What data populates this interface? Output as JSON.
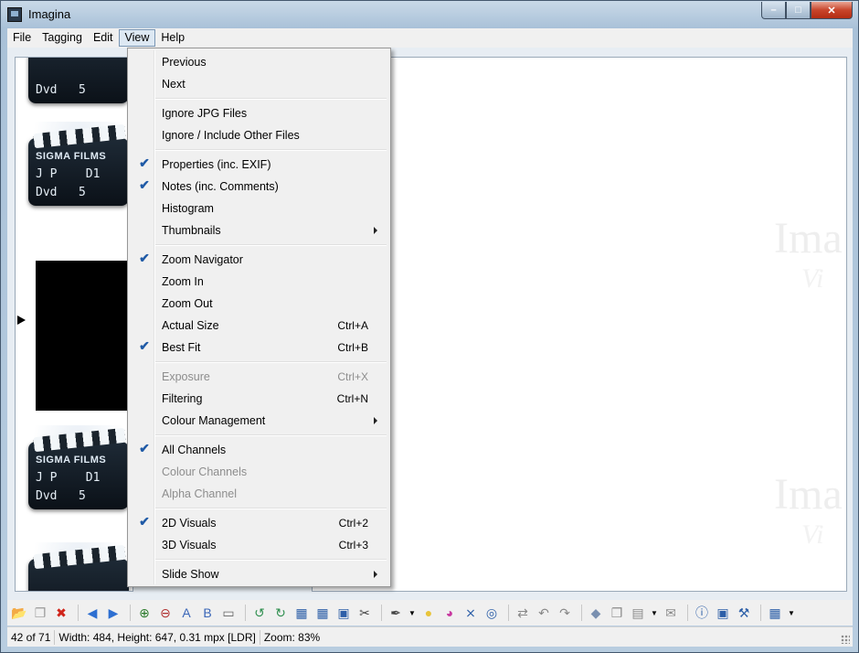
{
  "window": {
    "title": "Imagina"
  },
  "menubar": [
    "File",
    "Tagging",
    "Edit",
    "View",
    "Help"
  ],
  "view_menu": {
    "groups": [
      [
        {
          "label": "Previous",
          "shortcut": "",
          "checked": false,
          "disabled": false,
          "submenu": false
        },
        {
          "label": "Next",
          "shortcut": "",
          "checked": false,
          "disabled": false,
          "submenu": false
        }
      ],
      [
        {
          "label": "Ignore JPG Files",
          "shortcut": "",
          "checked": false,
          "disabled": false,
          "submenu": false
        },
        {
          "label": "Ignore / Include Other Files",
          "shortcut": "",
          "checked": false,
          "disabled": false,
          "submenu": false
        }
      ],
      [
        {
          "label": "Properties (inc. EXIF)",
          "shortcut": "",
          "checked": true,
          "disabled": false,
          "submenu": false
        },
        {
          "label": "Notes (inc. Comments)",
          "shortcut": "",
          "checked": true,
          "disabled": false,
          "submenu": false
        },
        {
          "label": "Histogram",
          "shortcut": "",
          "checked": false,
          "disabled": false,
          "submenu": false
        },
        {
          "label": "Thumbnails",
          "shortcut": "",
          "checked": false,
          "disabled": false,
          "submenu": true
        }
      ],
      [
        {
          "label": "Zoom Navigator",
          "shortcut": "",
          "checked": true,
          "disabled": false,
          "submenu": false
        },
        {
          "label": "Zoom In",
          "shortcut": "",
          "checked": false,
          "disabled": false,
          "submenu": false
        },
        {
          "label": "Zoom Out",
          "shortcut": "",
          "checked": false,
          "disabled": false,
          "submenu": false
        },
        {
          "label": "Actual Size",
          "shortcut": "Ctrl+A",
          "checked": false,
          "disabled": false,
          "submenu": false
        },
        {
          "label": "Best Fit",
          "shortcut": "Ctrl+B",
          "checked": true,
          "disabled": false,
          "submenu": false
        }
      ],
      [
        {
          "label": "Exposure",
          "shortcut": "Ctrl+X",
          "checked": false,
          "disabled": true,
          "submenu": false
        },
        {
          "label": "Filtering",
          "shortcut": "Ctrl+N",
          "checked": false,
          "disabled": false,
          "submenu": false
        },
        {
          "label": "Colour Management",
          "shortcut": "",
          "checked": false,
          "disabled": false,
          "submenu": true
        }
      ],
      [
        {
          "label": "All Channels",
          "shortcut": "",
          "checked": true,
          "disabled": false,
          "submenu": false
        },
        {
          "label": "Colour Channels",
          "shortcut": "",
          "checked": false,
          "disabled": true,
          "submenu": false
        },
        {
          "label": "Alpha Channel",
          "shortcut": "",
          "checked": false,
          "disabled": true,
          "submenu": false
        }
      ],
      [
        {
          "label": "2D Visuals",
          "shortcut": "Ctrl+2",
          "checked": true,
          "disabled": false,
          "submenu": false
        },
        {
          "label": "3D Visuals",
          "shortcut": "Ctrl+3",
          "checked": false,
          "disabled": false,
          "submenu": false
        }
      ],
      [
        {
          "label": "Slide Show",
          "shortcut": "",
          "checked": false,
          "disabled": false,
          "submenu": true
        }
      ]
    ]
  },
  "thumbnails": {
    "brand": "SIGMA FILMS",
    "row1": "J P",
    "row1_right": "D1",
    "row2": "Dvd",
    "row2_right": "5"
  },
  "viewer": {
    "watermark_big": "Ima",
    "watermark_small": "Vi"
  },
  "toolbar_icons": [
    "open-folder-icon",
    "copy-icon",
    "delete-icon",
    "previous-icon",
    "next-icon",
    "zoom-in-icon",
    "zoom-out-icon",
    "font-a-icon",
    "font-b-icon",
    "frame-icon",
    "rotate-left-icon",
    "rotate-right-icon",
    "grid-icon",
    "grid2-icon",
    "fill-icon",
    "scissors-icon",
    "eyedropper-icon",
    "bulb-icon",
    "colour-wheel-icon",
    "chart-icon",
    "radar-icon",
    "swap-icon",
    "undo-icon",
    "redo-icon",
    "tag-icon",
    "duplicate-icon",
    "stack-icon",
    "mail-icon",
    "info-icon",
    "save-icon",
    "settings-icon",
    "layout-icon"
  ],
  "status": {
    "position": "42 of 71",
    "details": "Width: 484, Height: 647, 0.31 mpx [LDR]",
    "zoom": "Zoom: 83%"
  }
}
